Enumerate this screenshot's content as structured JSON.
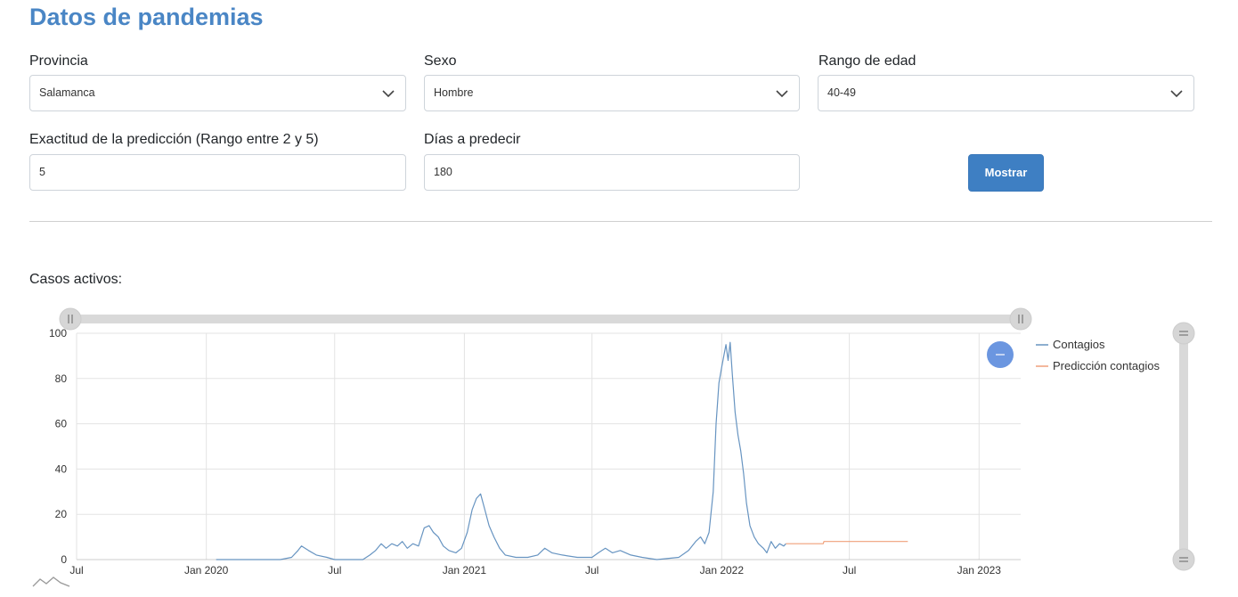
{
  "page": {
    "title": "Datos de pandemias"
  },
  "form": {
    "provincia": {
      "label": "Provincia",
      "value": "Salamanca"
    },
    "sexo": {
      "label": "Sexo",
      "value": "Hombre"
    },
    "edad": {
      "label": "Rango de edad",
      "value": "40-49"
    },
    "exactitud": {
      "label": "Exactitud de la predicción (Rango entre 2 y 5)",
      "value": "5"
    },
    "dias": {
      "label": "Días a predecir",
      "value": "180"
    },
    "submit_label": "Mostrar"
  },
  "section": {
    "label": "Casos activos:"
  },
  "colors": {
    "contagios": "#6794c1",
    "prediccion": "#f0a07a",
    "title": "#4a86c5",
    "button": "#3e7fc3",
    "zoom_button": "#6b96e0"
  },
  "chart_data": {
    "type": "line",
    "x_axis": {
      "type": "date",
      "range": [
        "2019-07-01",
        "2023-03-01"
      ],
      "ticks": [
        "Jul",
        "Jan 2020",
        "Jul",
        "Jan 2021",
        "Jul",
        "Jan 2022",
        "Jul",
        "Jan 2023"
      ]
    },
    "y_axis": {
      "range": [
        0,
        100
      ],
      "ticks": [
        "0",
        "20",
        "40",
        "60",
        "80",
        "100"
      ]
    },
    "grid": true,
    "legend": {
      "position": "right"
    },
    "series": [
      {
        "name": "Contagios",
        "points": [
          [
            "2020-01-15",
            0
          ],
          [
            "2020-04-15",
            0
          ],
          [
            "2020-05-01",
            1
          ],
          [
            "2020-05-10",
            4
          ],
          [
            "2020-05-15",
            6
          ],
          [
            "2020-05-25",
            4
          ],
          [
            "2020-06-05",
            2
          ],
          [
            "2020-06-20",
            1
          ],
          [
            "2020-07-01",
            0
          ],
          [
            "2020-08-10",
            0
          ],
          [
            "2020-08-20",
            2
          ],
          [
            "2020-08-28",
            4
          ],
          [
            "2020-09-05",
            7
          ],
          [
            "2020-09-12",
            5
          ],
          [
            "2020-09-20",
            7
          ],
          [
            "2020-09-28",
            6
          ],
          [
            "2020-10-05",
            8
          ],
          [
            "2020-10-12",
            5
          ],
          [
            "2020-10-20",
            7
          ],
          [
            "2020-10-28",
            6
          ],
          [
            "2020-11-05",
            14
          ],
          [
            "2020-11-12",
            15
          ],
          [
            "2020-11-18",
            12
          ],
          [
            "2020-11-25",
            10
          ],
          [
            "2020-12-02",
            6
          ],
          [
            "2020-12-10",
            4
          ],
          [
            "2020-12-20",
            3
          ],
          [
            "2020-12-28",
            5
          ],
          [
            "2021-01-05",
            12
          ],
          [
            "2021-01-12",
            22
          ],
          [
            "2021-01-18",
            27
          ],
          [
            "2021-01-24",
            29
          ],
          [
            "2021-01-30",
            22
          ],
          [
            "2021-02-05",
            15
          ],
          [
            "2021-02-12",
            10
          ],
          [
            "2021-02-20",
            5
          ],
          [
            "2021-02-28",
            2
          ],
          [
            "2021-03-15",
            1
          ],
          [
            "2021-04-01",
            1
          ],
          [
            "2021-04-15",
            2
          ],
          [
            "2021-04-25",
            5
          ],
          [
            "2021-05-05",
            3
          ],
          [
            "2021-05-20",
            2
          ],
          [
            "2021-06-10",
            1
          ],
          [
            "2021-07-01",
            1
          ],
          [
            "2021-07-10",
            3
          ],
          [
            "2021-07-20",
            5
          ],
          [
            "2021-07-30",
            3
          ],
          [
            "2021-08-10",
            4
          ],
          [
            "2021-08-25",
            2
          ],
          [
            "2021-09-10",
            1
          ],
          [
            "2021-10-01",
            0
          ],
          [
            "2021-11-01",
            1
          ],
          [
            "2021-11-15",
            4
          ],
          [
            "2021-11-25",
            8
          ],
          [
            "2021-12-02",
            10
          ],
          [
            "2021-12-08",
            7
          ],
          [
            "2021-12-14",
            12
          ],
          [
            "2021-12-20",
            30
          ],
          [
            "2021-12-24",
            60
          ],
          [
            "2021-12-28",
            78
          ],
          [
            "2022-01-01",
            85
          ],
          [
            "2022-01-04",
            90
          ],
          [
            "2022-01-07",
            95
          ],
          [
            "2022-01-10",
            88
          ],
          [
            "2022-01-13",
            96
          ],
          [
            "2022-01-16",
            82
          ],
          [
            "2022-01-20",
            65
          ],
          [
            "2022-01-24",
            55
          ],
          [
            "2022-01-28",
            48
          ],
          [
            "2022-02-01",
            38
          ],
          [
            "2022-02-05",
            25
          ],
          [
            "2022-02-10",
            15
          ],
          [
            "2022-02-16",
            10
          ],
          [
            "2022-02-22",
            7
          ],
          [
            "2022-03-01",
            5
          ],
          [
            "2022-03-06",
            3
          ],
          [
            "2022-03-12",
            8
          ],
          [
            "2022-03-18",
            5
          ],
          [
            "2022-03-24",
            7
          ],
          [
            "2022-03-30",
            6
          ],
          [
            "2022-04-02",
            7
          ]
        ]
      },
      {
        "name": "Predicción contagios",
        "points": [
          [
            "2022-04-02",
            7
          ],
          [
            "2022-05-25",
            7
          ],
          [
            "2022-05-26",
            8
          ],
          [
            "2022-09-22",
            8
          ]
        ]
      }
    ]
  }
}
